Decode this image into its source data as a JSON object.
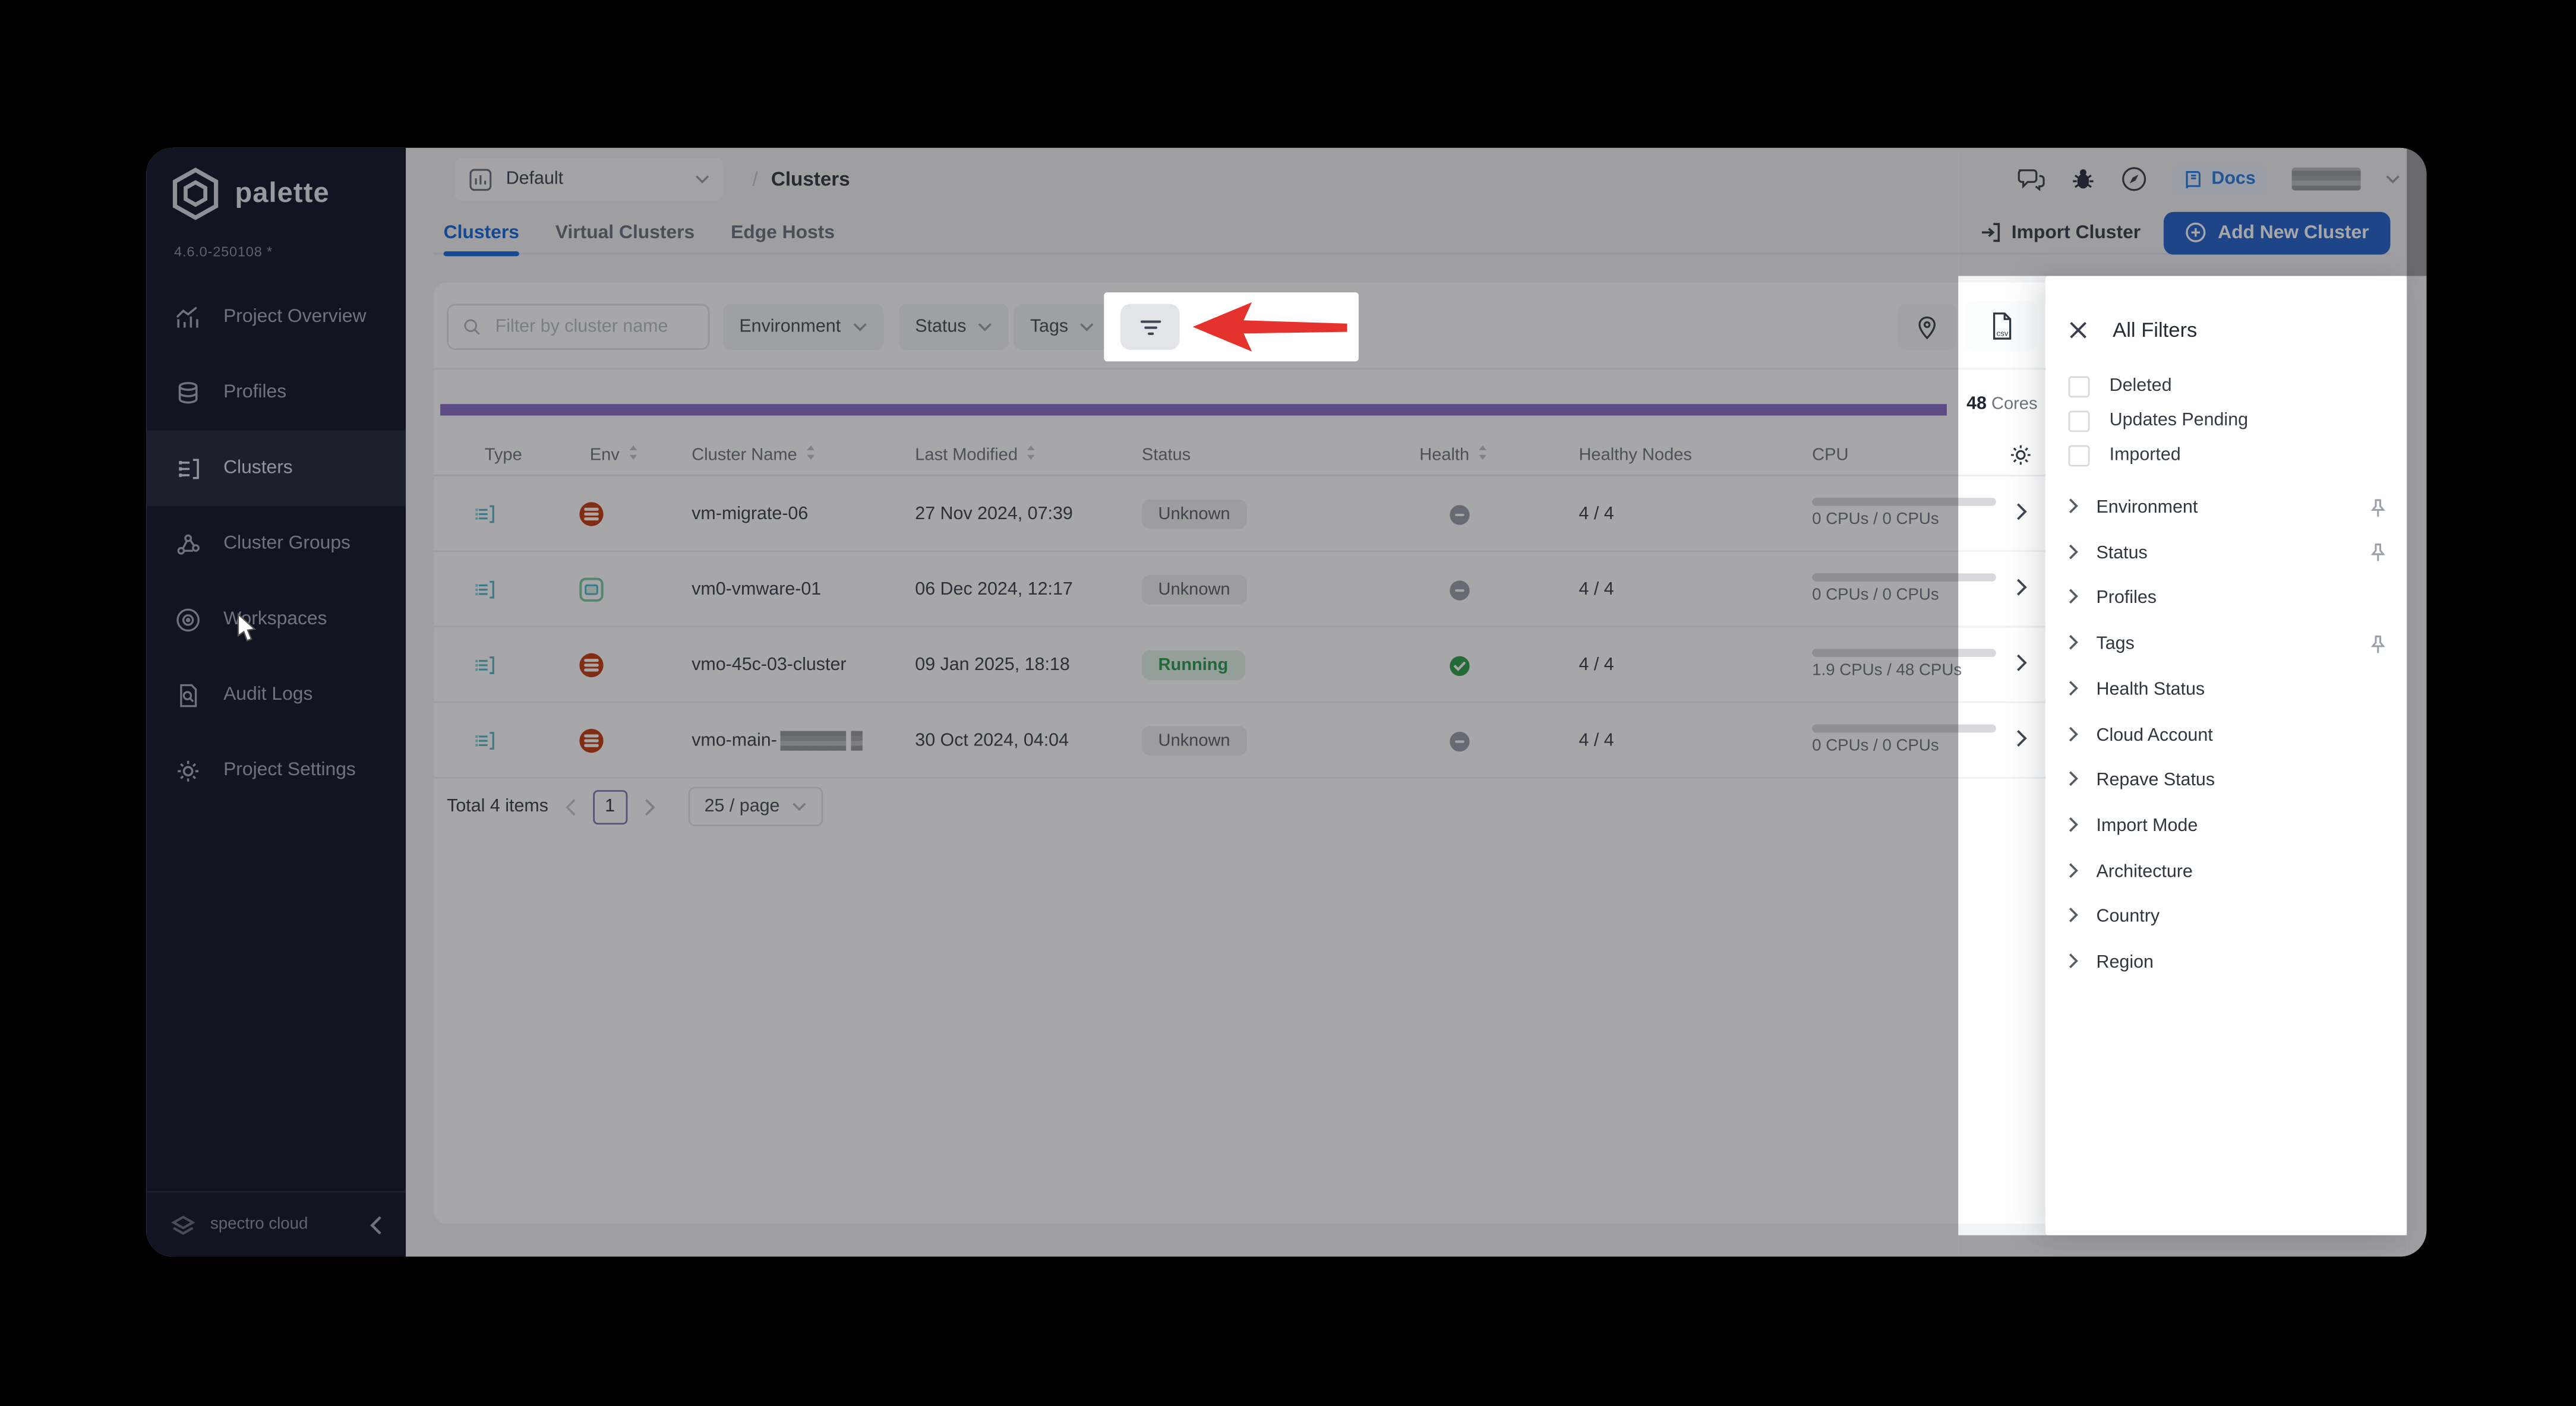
{
  "sidebar": {
    "logo_text": "palette",
    "version": "4.6.0-250108 *",
    "footer_text": "spectro cloud",
    "items": [
      {
        "id": "project-overview",
        "label": "Project Overview",
        "icon": "chart-icon",
        "active": false
      },
      {
        "id": "profiles",
        "label": "Profiles",
        "icon": "layers-icon",
        "active": false
      },
      {
        "id": "clusters",
        "label": "Clusters",
        "icon": "clusters-icon",
        "active": true
      },
      {
        "id": "cluster-groups",
        "label": "Cluster Groups",
        "icon": "nodes-icon",
        "active": false
      },
      {
        "id": "workspaces",
        "label": "Workspaces",
        "icon": "workspaces-icon",
        "active": false
      },
      {
        "id": "audit-logs",
        "label": "Audit Logs",
        "icon": "audit-icon",
        "active": false
      },
      {
        "id": "project-settings",
        "label": "Project Settings",
        "icon": "gear-icon",
        "active": false
      }
    ]
  },
  "topbar": {
    "project_label": "Default",
    "breadcrumb_sep": "/",
    "breadcrumb_current": "Clusters",
    "docs_label": "Docs"
  },
  "tabs": [
    {
      "label": "Clusters",
      "active": true
    },
    {
      "label": "Virtual Clusters",
      "active": false
    },
    {
      "label": "Edge Hosts",
      "active": false
    }
  ],
  "actions": {
    "import_label": "Import Cluster",
    "add_label": "Add New Cluster"
  },
  "filter_bar": {
    "search_placeholder": "Filter by cluster name",
    "dropdowns": [
      "Environment",
      "Status",
      "Tags"
    ]
  },
  "summary": {
    "cores_value": "48",
    "cores_label": "Cores"
  },
  "table": {
    "columns": [
      {
        "label": "Type",
        "sortable": false
      },
      {
        "label": "Env",
        "sortable": true
      },
      {
        "label": "Cluster Name",
        "sortable": true
      },
      {
        "label": "Last Modified",
        "sortable": true
      },
      {
        "label": "Status",
        "sortable": false
      },
      {
        "label": "Health",
        "sortable": true
      },
      {
        "label": "Healthy Nodes",
        "sortable": false
      },
      {
        "label": "CPU",
        "sortable": false
      }
    ],
    "rows": [
      {
        "type_icon": "cluster-type-icon",
        "env_icon": "openstack-env-icon",
        "name": "vm-migrate-06",
        "redacted": false,
        "modified": "27 Nov 2024, 07:39",
        "status": "Unknown",
        "status_variant": "unknown",
        "health": "none",
        "nodes": "4 / 4",
        "cpu_text": "0 CPUs / 0 CPUs",
        "cpu_fill": 0
      },
      {
        "type_icon": "cluster-type-icon",
        "env_icon": "vmware-env-icon",
        "name": "vm0-vmware-01",
        "redacted": false,
        "modified": "06 Dec 2024, 12:17",
        "status": "Unknown",
        "status_variant": "unknown",
        "health": "none",
        "nodes": "4 / 4",
        "cpu_text": "0 CPUs / 0 CPUs",
        "cpu_fill": 0
      },
      {
        "type_icon": "cluster-type-icon",
        "env_icon": "openstack-env-icon",
        "name": "vmo-45c-03-cluster",
        "redacted": false,
        "modified": "09 Jan 2025, 18:18",
        "status": "Running",
        "status_variant": "running",
        "health": "ok",
        "nodes": "4 / 4",
        "cpu_text": "1.9 CPUs / 48 CPUs",
        "cpu_fill": 0.04
      },
      {
        "type_icon": "cluster-type-icon",
        "env_icon": "openstack-env-icon",
        "name": "vmo-main-",
        "redacted": true,
        "modified": "30 Oct 2024, 04:04",
        "status": "Unknown",
        "status_variant": "unknown",
        "health": "none",
        "nodes": "4 / 4",
        "cpu_text": "0 CPUs / 0 CPUs",
        "cpu_fill": 0
      }
    ]
  },
  "pagination": {
    "total_label": "Total 4 items",
    "current_page": "1",
    "page_size_label": "25 / page"
  },
  "filter_panel": {
    "title": "All Filters",
    "checkboxes": [
      {
        "label": "Deleted",
        "checked": false
      },
      {
        "label": "Updates Pending",
        "checked": false
      },
      {
        "label": "Imported",
        "checked": false
      }
    ],
    "sections": [
      {
        "label": "Environment",
        "pinned": true
      },
      {
        "label": "Status",
        "pinned": true
      },
      {
        "label": "Profiles",
        "pinned": false
      },
      {
        "label": "Tags",
        "pinned": true
      },
      {
        "label": "Health Status",
        "pinned": false
      },
      {
        "label": "Cloud Account",
        "pinned": false
      },
      {
        "label": "Repave Status",
        "pinned": false
      },
      {
        "label": "Import Mode",
        "pinned": false
      },
      {
        "label": "Architecture",
        "pinned": false
      },
      {
        "label": "Country",
        "pinned": false
      },
      {
        "label": "Region",
        "pinned": false
      }
    ]
  },
  "colors": {
    "accent_blue": "#1a6bd8",
    "primary_button": "#2a66cc",
    "progress_purple": "#8d6fc5",
    "running_green": "#2e9e4f",
    "arrow_red": "#e5322c",
    "sidebar_bg": "#151b2c"
  }
}
